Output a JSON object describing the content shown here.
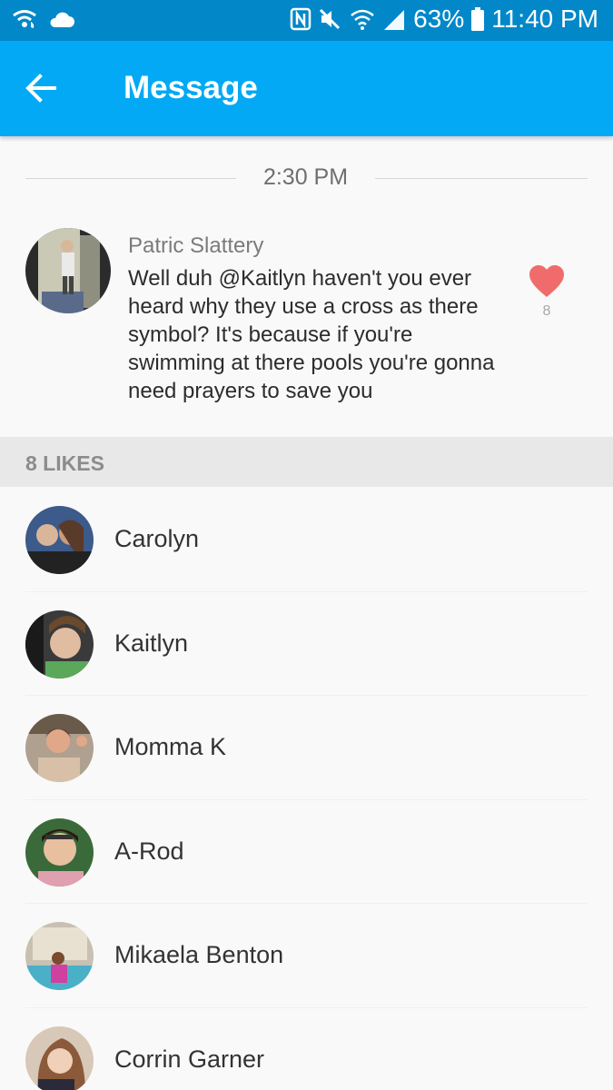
{
  "status_bar": {
    "battery": "63%",
    "time": "11:40 PM",
    "icons": [
      "wifi-calling-icon",
      "cloud-icon",
      "nfc-icon",
      "mute-icon",
      "wifi-icon",
      "signal-icon",
      "battery-icon"
    ]
  },
  "app_bar": {
    "title": "Message",
    "back_icon": "arrow-left-icon"
  },
  "timestamp": "2:30 PM",
  "message": {
    "author": "Patric Slattery",
    "text": "Well duh @Kaitlyn haven't you ever heard why they use a cross as there symbol? It's because if you're swimming at there pools you're gonna need prayers to save you",
    "like_count": "8",
    "heart_color": "#f06c6c"
  },
  "likes_header": "8 LIKES",
  "likers": [
    {
      "name": "Carolyn"
    },
    {
      "name": "Kaitlyn"
    },
    {
      "name": "Momma K"
    },
    {
      "name": "A-Rod"
    },
    {
      "name": "Mikaela Benton"
    },
    {
      "name": "Corrin Garner"
    }
  ],
  "colors": {
    "status_bar": "#0288c9",
    "app_bar": "#03a9f4",
    "background": "#f9f9f9"
  }
}
